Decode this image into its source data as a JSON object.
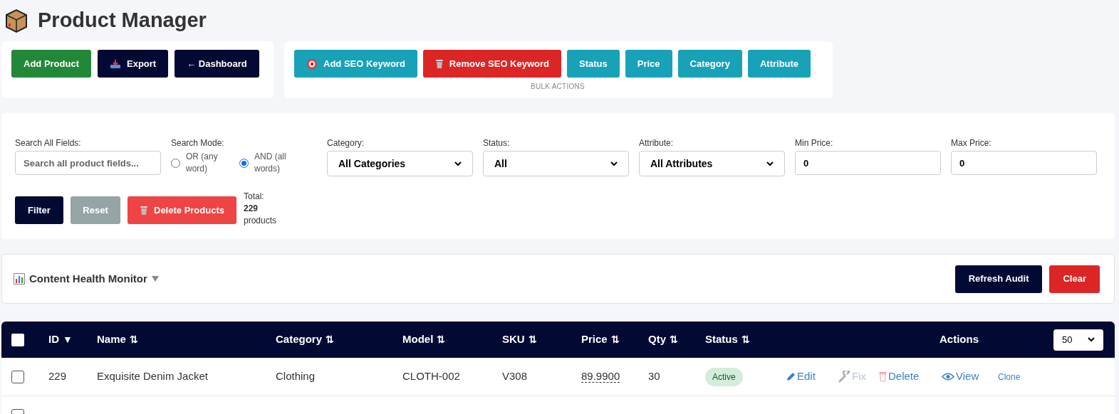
{
  "title": "Product Manager",
  "main_actions": [
    {
      "label": "Add Product",
      "kind": "green"
    },
    {
      "label": "Export",
      "kind": "navy"
    },
    {
      "label": "← Dashboard",
      "kind": "navy"
    }
  ],
  "bulk_actions": [
    {
      "label": "Add SEO Keyword",
      "kind": "teal"
    },
    {
      "label": "Remove SEO Keyword",
      "kind": "red"
    },
    {
      "label": "Status",
      "kind": "teal"
    },
    {
      "label": "Price",
      "kind": "teal"
    },
    {
      "label": "Category",
      "kind": "teal"
    },
    {
      "label": "Attribute",
      "kind": "teal"
    }
  ],
  "bulk_caption": "BULK ACTIONS",
  "filters": {
    "search_label": "Search All Fields:",
    "search_placeholder": "Search all product fields...",
    "mode_label": "Search Mode:",
    "modes": [
      {
        "label": "OR (any word)",
        "selected": false
      },
      {
        "label": "AND (all words)",
        "selected": true
      }
    ],
    "selects": [
      {
        "label": "Category:",
        "value": "All Categories"
      },
      {
        "label": "Status:",
        "value": "All"
      },
      {
        "label": "Attribute:",
        "value": "All Attributes"
      }
    ],
    "prices": [
      {
        "label": "Min Price:",
        "value": "0"
      },
      {
        "label": "Max Price:",
        "value": "0"
      }
    ],
    "buttons": [
      {
        "label": "Filter",
        "kind": "navy"
      },
      {
        "label": "Reset",
        "kind": "gray"
      },
      {
        "label": "Delete Products",
        "kind": "lightred"
      }
    ],
    "total_label": "Total:",
    "total_count": "229",
    "total_unit": "products"
  },
  "health": {
    "title": "Content Health Monitor",
    "expanded": false,
    "buttons": [
      {
        "label": "Refresh Audit",
        "kind": "navy"
      },
      {
        "label": "Clear",
        "kind": "red"
      }
    ]
  },
  "table": {
    "select_all_checked": false,
    "columns": [
      {
        "label": "ID",
        "sort_icon": "▼"
      },
      {
        "label": "Name",
        "sort_icon": "⇅"
      },
      {
        "label": "Category",
        "sort_icon": "⇅"
      },
      {
        "label": "Model",
        "sort_icon": "⇅"
      },
      {
        "label": "SKU",
        "sort_icon": "⇅"
      },
      {
        "label": "Price",
        "sort_icon": "⇅"
      },
      {
        "label": "Qty",
        "sort_icon": "⇅"
      },
      {
        "label": "Status",
        "sort_icon": "⇅"
      }
    ],
    "actions_label": "Actions",
    "page_size": "50",
    "rows": [
      {
        "checked": false,
        "id": "229",
        "name": "Exquisite Denim Jacket",
        "category": "Clothing",
        "model": "CLOTH-002",
        "sku": "V308",
        "price": "89.9900",
        "qty": "30",
        "status": "Active",
        "actions": [
          "Edit",
          "Fix",
          "Delete",
          "View",
          "Clone"
        ]
      },
      {
        "checked": false
      }
    ]
  }
}
